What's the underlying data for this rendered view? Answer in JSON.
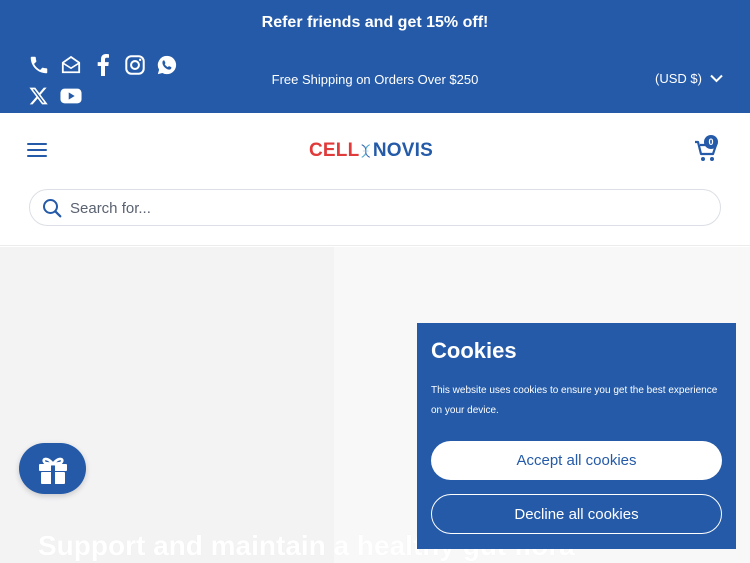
{
  "announcement": {
    "promo": "Refer friends and get 15% off!",
    "shipping": "Free Shipping on Orders Over $250"
  },
  "social": {
    "icons": [
      "phone-icon",
      "email-icon",
      "facebook-icon",
      "instagram-icon",
      "whatsapp-icon",
      "x-icon",
      "youtube-icon"
    ]
  },
  "currency": {
    "selected": "(USD $)"
  },
  "header": {
    "logo": {
      "part1": "CELL",
      "part2": "NOVIS"
    },
    "cart_count": "0",
    "search_placeholder": "Search for..."
  },
  "hero": {
    "title": "Support and maintain a healthy gut flora"
  },
  "cookie_banner": {
    "title": "Cookies",
    "text": "This website uses cookies to ensure you get the best experience on your device.",
    "accept_label": "Accept all cookies",
    "decline_label": "Decline all cookies"
  },
  "colors": {
    "brand_blue": "#245aa8",
    "logo_red": "#e03a3a",
    "white": "#ffffff"
  }
}
